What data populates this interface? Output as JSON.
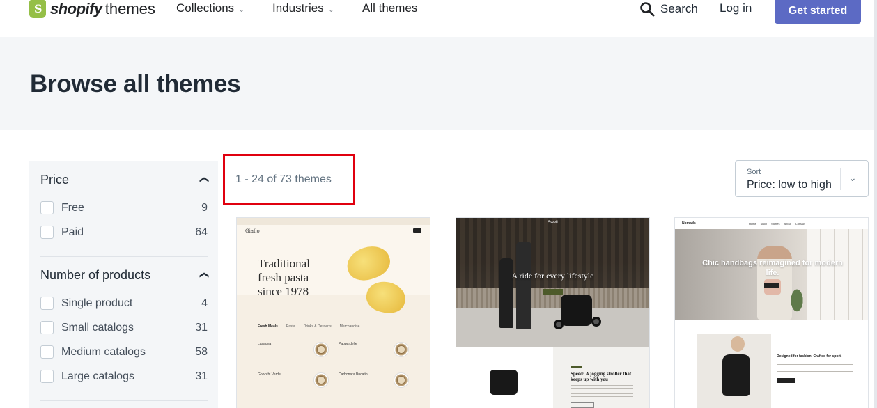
{
  "nav": {
    "logo_bold": "shopify",
    "logo_light": "themes",
    "links": [
      {
        "label": "Collections",
        "has_dropdown": true
      },
      {
        "label": "Industries",
        "has_dropdown": true
      },
      {
        "label": "All themes",
        "has_dropdown": false
      }
    ],
    "search_label": "Search",
    "login_label": "Log in",
    "cta_label": "Get started"
  },
  "hero": {
    "title": "Browse all themes"
  },
  "filters": {
    "price": {
      "heading": "Price",
      "options": [
        {
          "label": "Free",
          "count": "9"
        },
        {
          "label": "Paid",
          "count": "64"
        }
      ]
    },
    "products": {
      "heading": "Number of products",
      "options": [
        {
          "label": "Single product",
          "count": "4"
        },
        {
          "label": "Small catalogs",
          "count": "31"
        },
        {
          "label": "Medium catalogs",
          "count": "58"
        },
        {
          "label": "Large catalogs",
          "count": "31"
        }
      ]
    }
  },
  "results": {
    "count_text": "1 - 24 of 73 themes"
  },
  "sort": {
    "label": "Sort",
    "value": "Price: low to high"
  },
  "cards": [
    {
      "brand": "Giallo",
      "headline_1": "Traditional",
      "headline_2": "fresh pasta",
      "headline_3": "since 1978",
      "tabs": [
        "Fresh Meals",
        "Pasta",
        "Drinks & Desserts",
        "Merchandise"
      ],
      "items": [
        "Lasagna",
        "Pappardelle",
        "Gnocchi Verde",
        "Carbonara Bucatini"
      ]
    },
    {
      "brand": "Swell",
      "tagline": "A ride for every lifestyle",
      "feature_title": "Speed: A jogging stroller that keeps up with you"
    },
    {
      "brand": "Nomads",
      "menu": [
        "Home",
        "Shop",
        "Stories",
        "About",
        "Contact"
      ],
      "tagline": "Chic handbags reimagined for modern life.",
      "feature_title": "Designed for fashion. Crafted for sport."
    }
  ],
  "colors": {
    "cta": "#5c6ac4",
    "hero_bg": "#f4f6f8",
    "highlight": "#e0000f",
    "logo_green": "#95bf47"
  }
}
